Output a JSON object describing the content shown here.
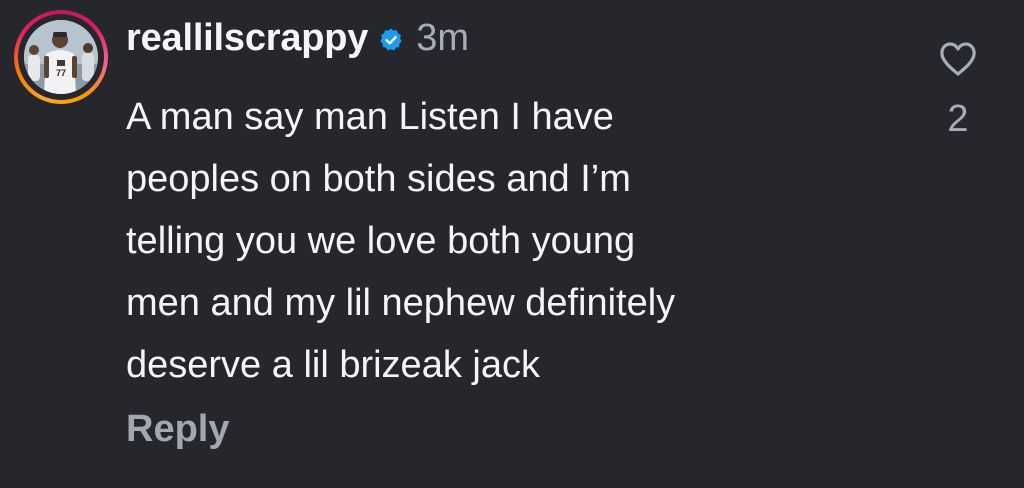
{
  "comment": {
    "username": "reallilscrappy",
    "verified_icon": "verified-badge-icon",
    "timestamp": "3m",
    "text": "A man say man Listen I have\npeoples on both sides and I’m\ntelling you we love both young\nmen and my lil nephew definitely\ndeserve a lil brizeak jack",
    "reply_label": "Reply",
    "like_icon": "heart-outline-icon",
    "like_count": "2"
  },
  "colors": {
    "background": "#25272c",
    "primary_text": "#f4f5f7",
    "secondary_text": "#a8adb5",
    "verified_blue": "#1d9bf0"
  }
}
